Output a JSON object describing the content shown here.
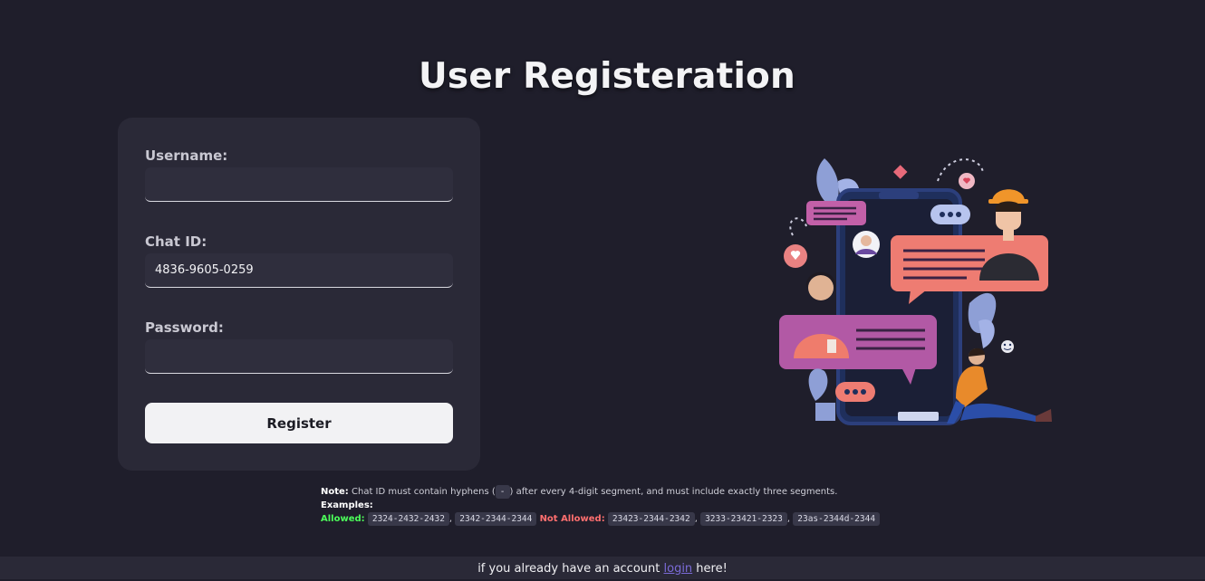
{
  "page": {
    "title": "User Registeration"
  },
  "form": {
    "username": {
      "label": "Username:",
      "value": "",
      "placeholder": ""
    },
    "chat_id": {
      "label": "Chat ID:",
      "value": "4836-9605-0259",
      "placeholder": ""
    },
    "password": {
      "label": "Password:",
      "value": "",
      "placeholder": ""
    },
    "register_label": "Register"
  },
  "notes": {
    "note_label": "Note:",
    "note_text_1": "Chat ID must contain hyphens (",
    "hyphen": "-",
    "note_text_2": ") after every 4-digit segment, and must include exactly three segments.",
    "examples_label": "Examples:",
    "allowed_label": "Allowed:",
    "allowed": [
      "2324-2432-2432",
      "2342-2344-2344"
    ],
    "not_allowed_label": "Not Allowed:",
    "not_allowed": [
      "23423-2344-2342",
      "3233-23421-2323",
      "23as-2344d-2344"
    ],
    "separator": ","
  },
  "footer": {
    "text_before": "if you already have an account ",
    "link_text": "login",
    "text_after": " here!"
  },
  "colors": {
    "background": "#1f1e2b",
    "card": "#2a2937",
    "allowed": "#4cff5a",
    "not_allowed": "#ff6f6f",
    "link": "#7b6bd8"
  },
  "illustration": {
    "icon": "chat-people-illustration"
  }
}
